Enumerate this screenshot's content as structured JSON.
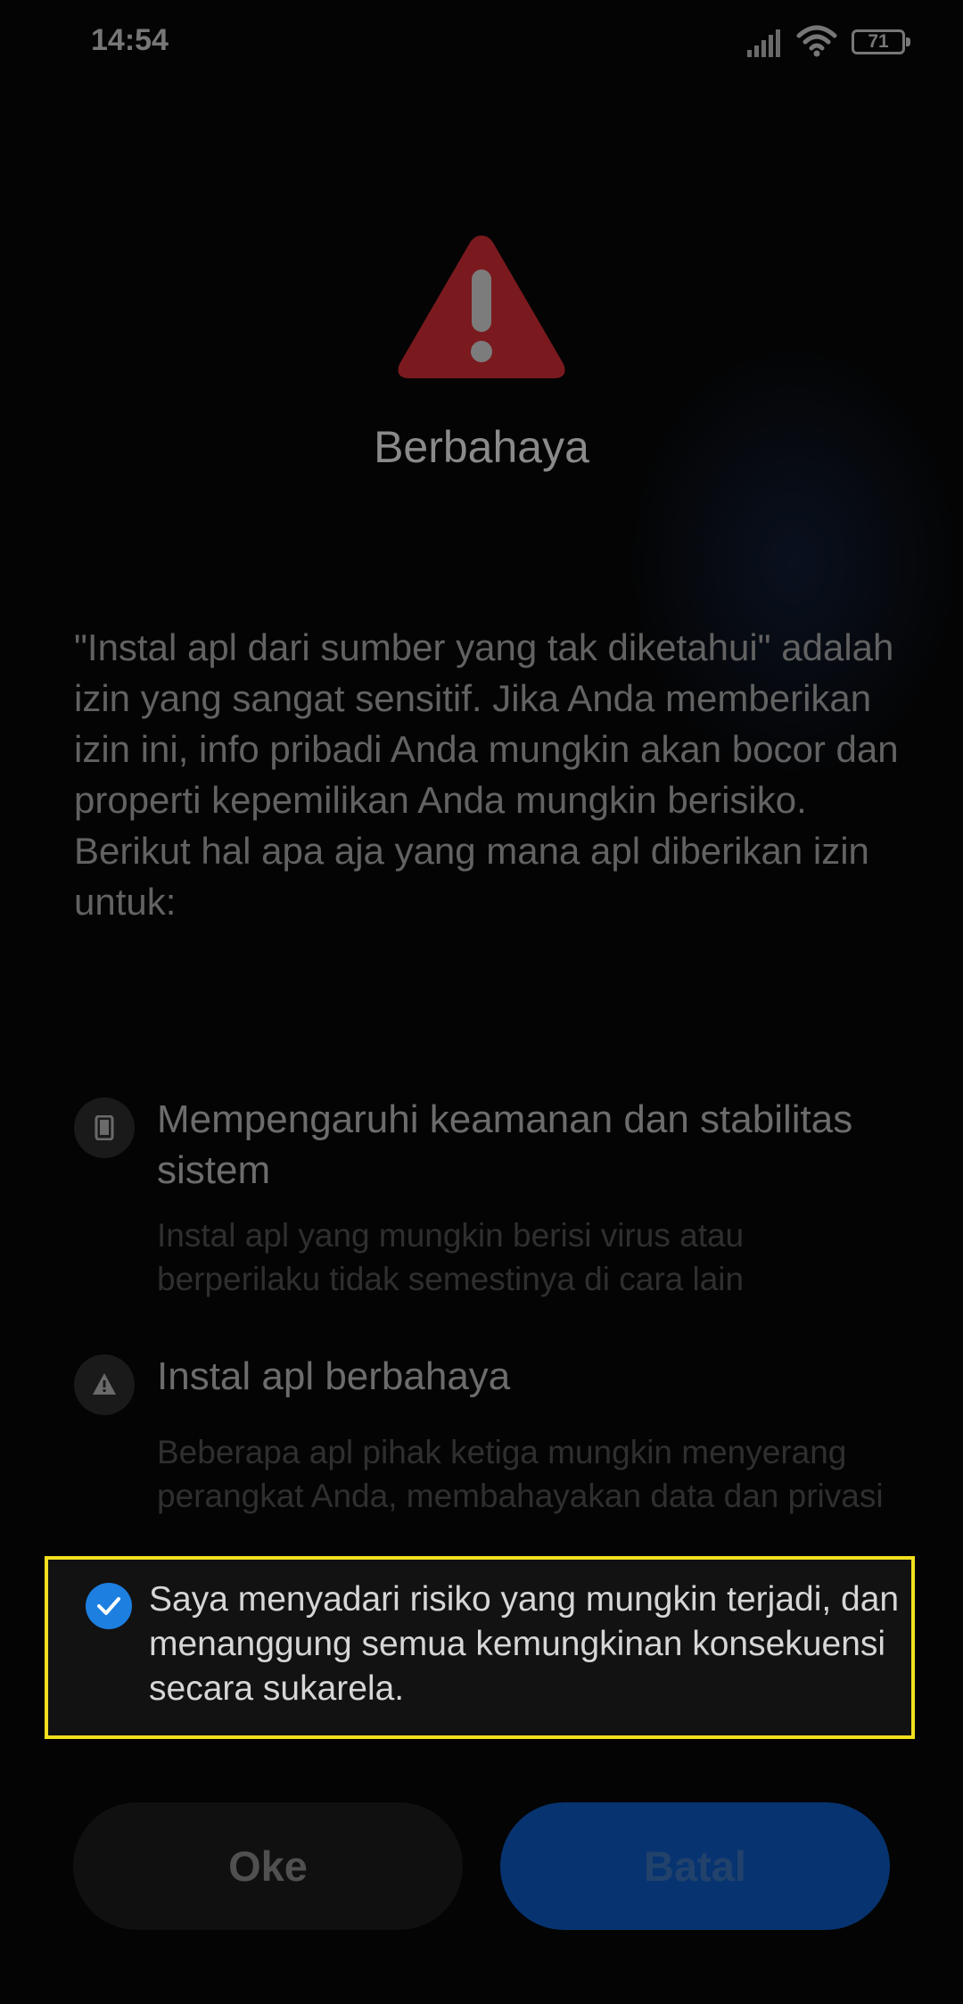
{
  "status_bar": {
    "time": "14:54",
    "battery_level": "71",
    "icons": [
      "signal-icon",
      "wifi-icon",
      "battery-icon"
    ]
  },
  "dialog": {
    "icon": "warning-triangle-icon",
    "title": "Berbahaya",
    "description": "\"Instal apl dari sumber yang tak diketahui\" adalah izin yang sangat sensitif. Jika Anda memberikan izin ini, info pribadi Anda mungkin akan bocor dan properti kepemilikan Anda mungkin berisiko. Berikut hal apa aja yang mana apl diberikan izin untuk:",
    "permissions": [
      {
        "icon": "phone-icon",
        "title": "Mempengaruhi keamanan dan stabilitas sistem",
        "desc": "Instal apl yang mungkin berisi virus atau berperilaku tidak semestinya di cara lain"
      },
      {
        "icon": "warning-small-icon",
        "title": "Instal apl berbahaya",
        "desc": "Beberapa apl pihak ketiga mungkin menyerang perangkat Anda, membahayakan data dan privasi Anda"
      }
    ],
    "consent": {
      "checked": true,
      "text": "Saya menyadari risiko yang mungkin terjadi, dan menanggung semua kemungkinan konsekuensi secara sukarela."
    },
    "buttons": {
      "ok": "Oke",
      "cancel": "Batal"
    }
  },
  "colors": {
    "accent": "#1d7fe0",
    "warning": "#7a1a1e",
    "highlight": "#f2df1f",
    "cancel_bg": "#073470"
  }
}
